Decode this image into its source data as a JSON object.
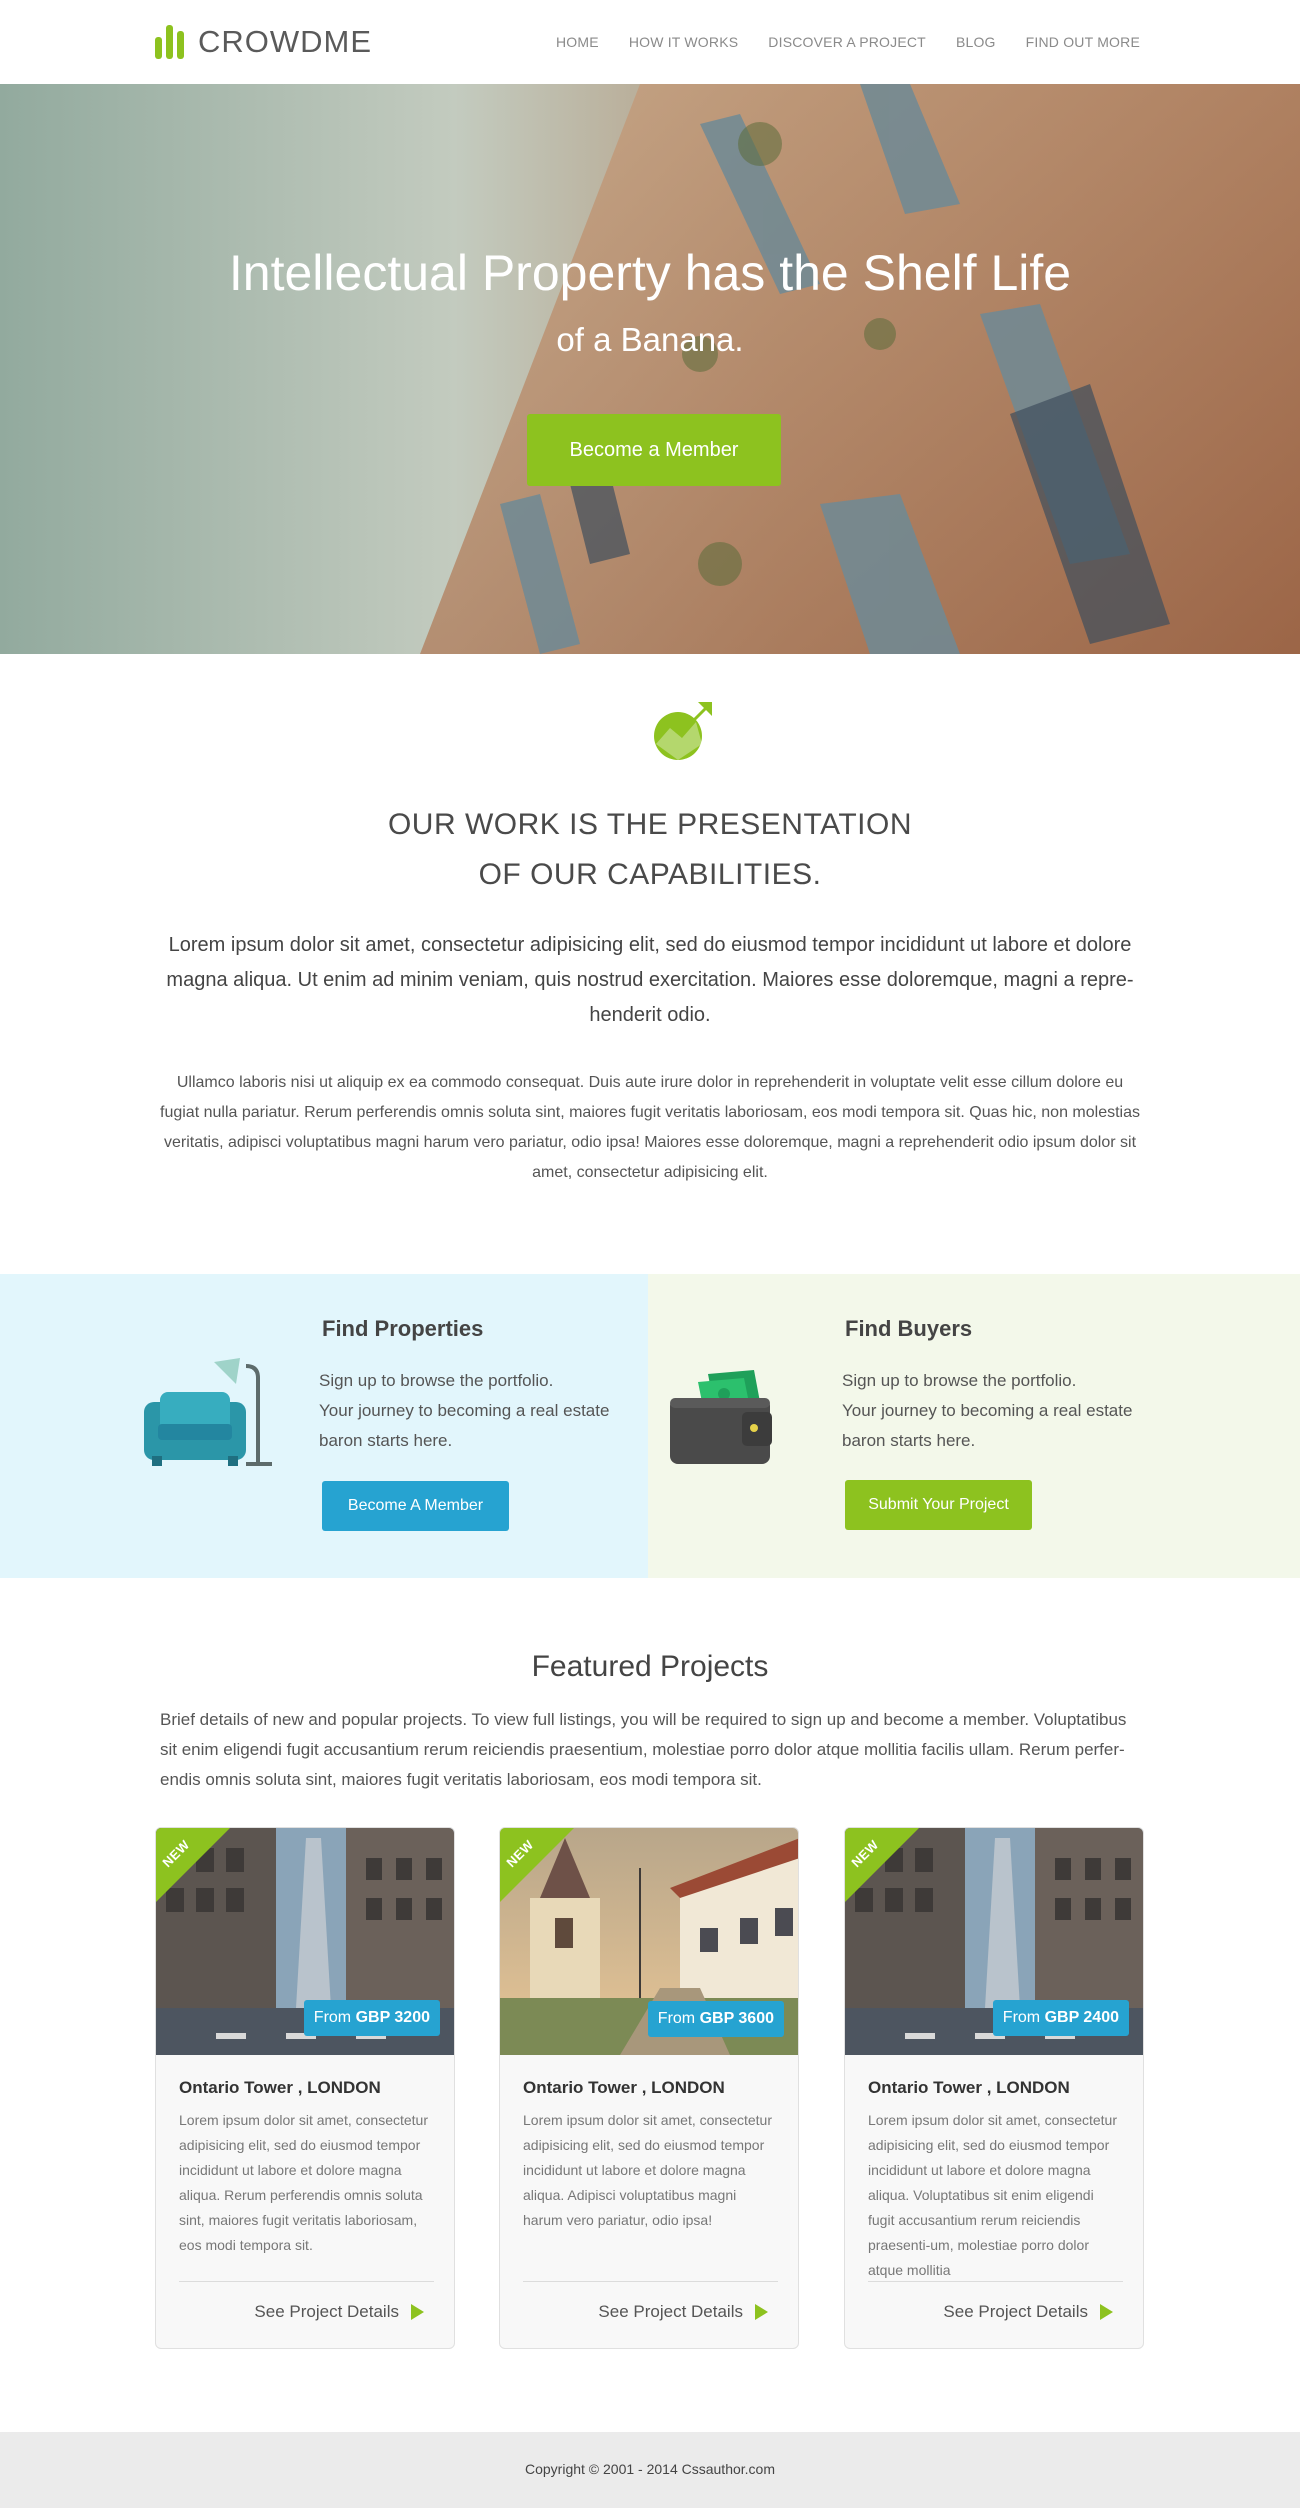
{
  "brand": {
    "name": "CROWDME",
    "accent": "#8dc21f",
    "blue": "#26a3d1"
  },
  "nav": [
    "HOME",
    "HOW IT WORKS",
    "DISCOVER A PROJECT",
    "BLOG",
    "FIND OUT MORE"
  ],
  "hero": {
    "title": "Intellectual Property has the Shelf Life",
    "subtitle": "of a Banana.",
    "button": "Become a Member"
  },
  "about": {
    "icon": "growth-chart-icon",
    "title_line1": "OUR WORK IS THE PRESENTATION",
    "title_line2": "OF OUR CAPABILITIES.",
    "lead": "Lorem ipsum dolor sit amet, consectetur adipisicing elit, sed do eiusmod tempor incididunt ut labore et dolore magna aliqua. Ut enim ad minim veniam, quis nostrud exercitation. Maiores esse doloremque, magni a repre-henderit odio.",
    "body": "Ullamco laboris nisi ut aliquip ex ea commodo consequat. Duis aute irure dolor in reprehenderit in voluptate velit esse cillum dolore eu fugiat nulla pariatur. Rerum perferendis omnis soluta sint, maiores fugit veritatis laboriosam, eos modi tempora sit. Quas hic, non molestias veritatis, adipisci voluptatibus magni harum vero pariatur, odio ipsa! Maiores esse doloremque, magni a reprehenderit odio  ipsum dolor sit amet, consectetur adipisicing elit."
  },
  "panels": {
    "left": {
      "icon": "armchair-lamp-icon",
      "title": "Find Properties",
      "line1": "Sign up to browse the portfolio.",
      "line2": "Your journey to becoming a real estate baron starts here.",
      "button": "Become A Member"
    },
    "right": {
      "icon": "wallet-icon",
      "title": "Find Buyers",
      "line1": "Sign up to browse the portfolio.",
      "line2": "Your journey to becoming a real estate baron starts here.",
      "button": "Submit Your Project"
    }
  },
  "featured": {
    "title": "Featured Projects",
    "description": "Brief details of new and popular projects. To view full listings, you will be required to  sign up and become a member. Voluptatibus sit enim eligendi fugit accusantium rerum reiciendis praesentium, molestiae porro dolor atque mollitia facilis ullam. Rerum perfer-endis omnis soluta sint, maiores fugit veritatis laboriosam, eos modi tempora sit.",
    "cards": [
      {
        "badge": "NEW",
        "price_prefix": "From ",
        "price": "GBP 3200",
        "title": "Ontario Tower , LONDON",
        "text": "Lorem ipsum dolor sit amet, consectetur adipisicing elit, sed do eiusmod tempor incididunt ut labore et dolore magna aliqua. Rerum perferendis omnis soluta sint, maiores fugit veritatis laboriosam, eos modi tempora sit.",
        "link": "See Project Details"
      },
      {
        "badge": "NEW",
        "price_prefix": "From ",
        "price": "GBP 3600",
        "title": "Ontario Tower , LONDON",
        "text": "Lorem ipsum dolor sit amet, consectetur adipisicing elit, sed do eiusmod tempor incididunt ut labore et dolore magna aliqua. Adipisci voluptatibus magni harum vero pariatur, odio ipsa!",
        "link": "See Project Details"
      },
      {
        "badge": "NEW",
        "price_prefix": "From ",
        "price": "GBP 2400",
        "title": "Ontario Tower , LONDON",
        "text": "Lorem ipsum dolor sit amet, consectetur adipisicing elit, sed do eiusmod tempor incididunt ut labore et dolore magna aliqua. Voluptatibus sit enim eligendi fugit accusantium rerum reiciendis praesenti-um, molestiae porro dolor atque mollitia",
        "link": "See Project Details"
      }
    ]
  },
  "footer": {
    "copyright": "Copyright © 2001 - 2014  Cssauthor.com"
  }
}
